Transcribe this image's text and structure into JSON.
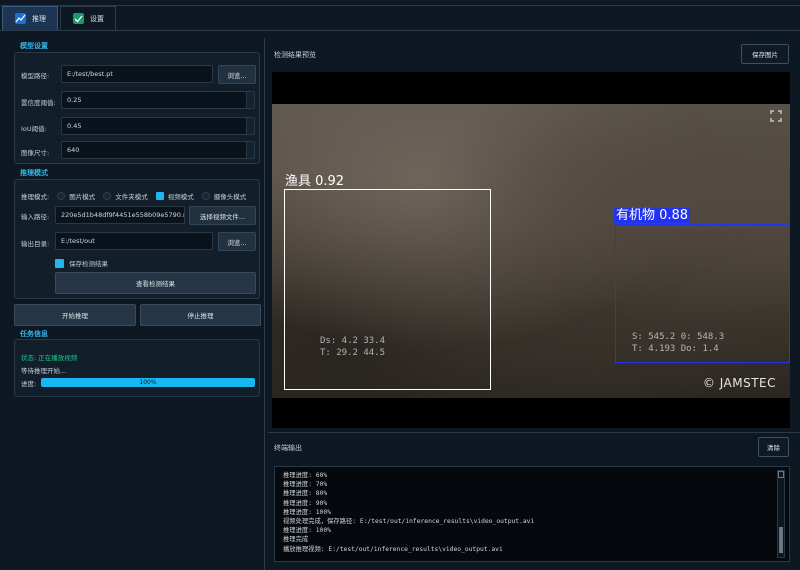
{
  "tabs": [
    {
      "label": "推理",
      "icon": "chart-line-icon",
      "active": true
    },
    {
      "label": "设置",
      "icon": "checkbox-icon",
      "active": false
    }
  ],
  "model": {
    "section_title": "模型设置",
    "path_label": "模型路径:",
    "path_value": "E:/test/best.pt",
    "browse_label": "浏览...",
    "conf_label": "置信度阈值:",
    "conf_value": "0.25",
    "iou_label": "IoU阈值:",
    "iou_value": "0.45",
    "imgsz_label": "图像尺寸:",
    "imgsz_value": "640"
  },
  "inference_mode": {
    "section_title": "推理模式",
    "mode_label": "推理模式:",
    "modes": [
      "图片模式",
      "文件夹模式",
      "视频模式",
      "摄像头模式"
    ],
    "selected_mode": "视频模式",
    "input_label": "输入路径:",
    "input_value": "220e5d1b48df9f4451e558b09e5790.mp4",
    "select_video_label": "选择视频文件...",
    "output_label": "输出目录:",
    "output_value": "E:/test/out",
    "browse_label": "浏览...",
    "save_checkbox_label": "保存检测结果",
    "view_results_label": "查看检测结果"
  },
  "actions": {
    "start_label": "开始推理",
    "stop_label": "停止推理"
  },
  "task": {
    "section_title": "任务信息",
    "status": "状态: 正在播放视频",
    "message": "等待推理开始...",
    "progress_label": "进度:",
    "progress_value": 100,
    "progress_text": "100%"
  },
  "preview": {
    "title": "检测结果预览",
    "save_image_label": "保存图片",
    "detections": [
      {
        "label": "渔具 0.92",
        "color": "#ffffff"
      },
      {
        "label": "有机物 0.88",
        "color": "#2233ee"
      }
    ],
    "hud_left": [
      "Ds: 4.2   33.4",
      "T: 29.2   44.5"
    ],
    "hud_right": [
      "S: 545.2   0: 548.3",
      "T: 4.193   Do: 1.4"
    ],
    "watermark": "© JAMSTEC"
  },
  "console": {
    "title": "终端输出",
    "clear_label": "清除",
    "lines": [
      "推理进度: 60%",
      "推理进度: 70%",
      "推理进度: 80%",
      "推理进度: 90%",
      "推理进度: 100%",
      "视频处理完成，保存路径: E:/test/out/inference_results\\video_output.avi",
      "推理进度: 100%",
      "推理完成",
      "播放推理视频: E:/test/out/inference_results\\video_output.avi"
    ]
  },
  "colors": {
    "accent": "#21b6ef",
    "background": "#0e1822",
    "group_title": "#2fb7e8"
  }
}
